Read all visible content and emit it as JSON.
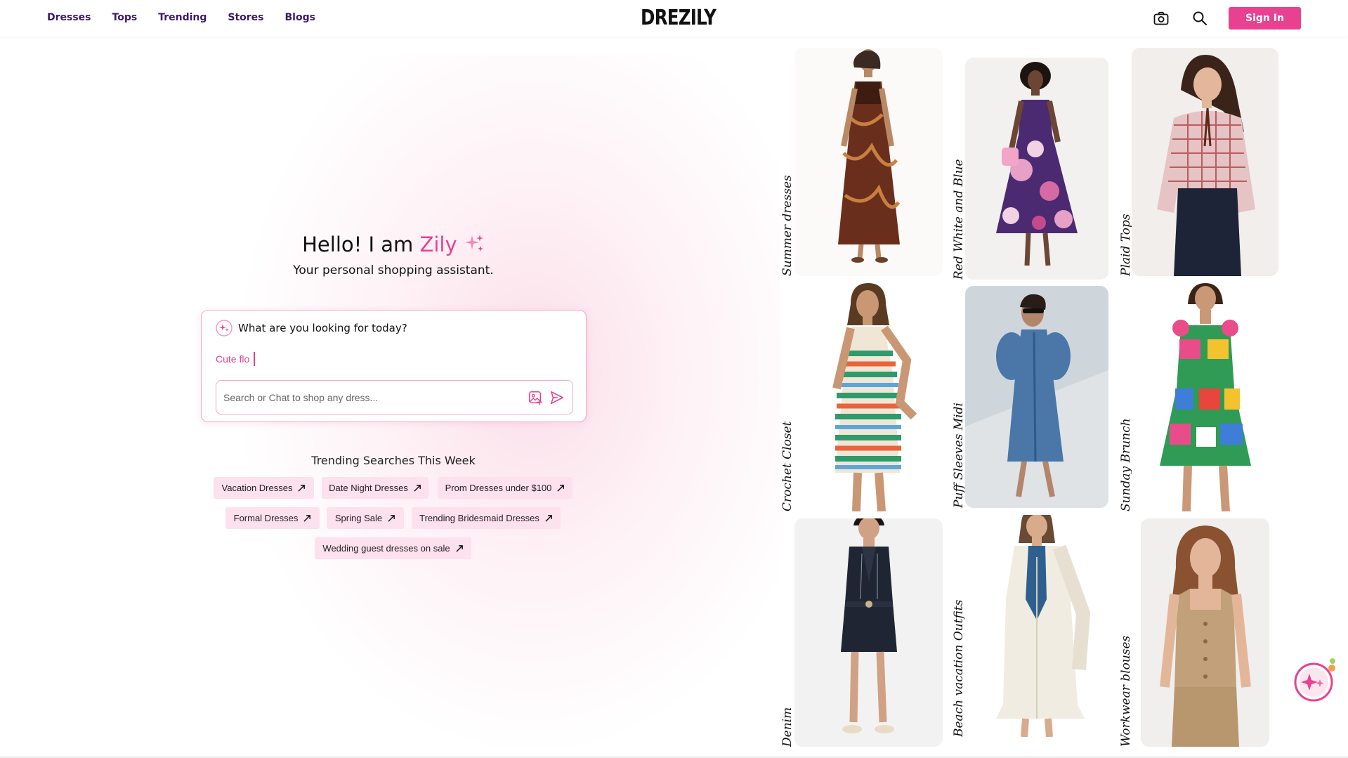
{
  "header": {
    "nav": [
      "Dresses",
      "Tops",
      "Trending",
      "Stores",
      "Blogs"
    ],
    "logo": "DREZILY",
    "icons": [
      "camera-icon",
      "search-icon"
    ],
    "signin_label": "Sign In"
  },
  "hero": {
    "greeting": "Hello! I am",
    "name": "Zily",
    "subtitle": "Your personal shopping assistant."
  },
  "chat": {
    "question": "What are you looking for today?",
    "typing_text": "Cute flo",
    "search_placeholder": "Search or Chat to shop any dress..."
  },
  "trending": {
    "title": "Trending Searches This Week",
    "chips": [
      "Vacation Dresses",
      "Date Night Dresses",
      "Prom Dresses under $100",
      "Formal Dresses",
      "Spring Sale",
      "Trending Bridesmaid Dresses",
      "Wedding guest dresses on sale"
    ]
  },
  "gallery": {
    "labels": [
      "Summer dresses",
      "Red White and Blue",
      "Plaid Tops",
      "Crochet Closet",
      "Puff Sleeves Midi",
      "Sunday Brunch",
      "Denim",
      "Beach vacation Outfits",
      "Workwear blouses"
    ]
  },
  "colors": {
    "accent": "#e8418f",
    "nav_text": "#3b1a6b",
    "chip_bg": "#fde1ec"
  }
}
